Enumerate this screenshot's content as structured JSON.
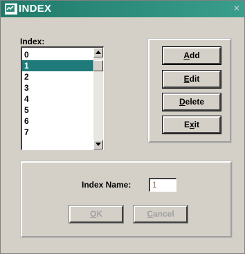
{
  "window": {
    "title": "INDEX",
    "close_glyph": "✕",
    "icon": "app-window-icon"
  },
  "index_list": {
    "label": "Index:",
    "items": [
      "0",
      "1",
      "2",
      "3",
      "4",
      "5",
      "6",
      "7"
    ],
    "selected": "1"
  },
  "actions": {
    "add": {
      "pre": "",
      "key": "A",
      "post": "dd"
    },
    "edit": {
      "pre": "",
      "key": "E",
      "post": "dit"
    },
    "delete": {
      "pre": "",
      "key": "D",
      "post": "elete"
    },
    "exit": {
      "pre": "E",
      "key": "x",
      "post": "it"
    }
  },
  "index_name": {
    "label": "Index Name:",
    "value": "1"
  },
  "dialog_buttons": {
    "ok": {
      "pre": "",
      "key": "O",
      "post": "K"
    },
    "cancel": {
      "pre": "",
      "key": "C",
      "post": "ancel"
    }
  },
  "colors": {
    "titlebar": "#2e8b7a",
    "selection": "#1f7a7a",
    "face": "#d4d0c8",
    "disabled_text": "#a0a0a0"
  }
}
